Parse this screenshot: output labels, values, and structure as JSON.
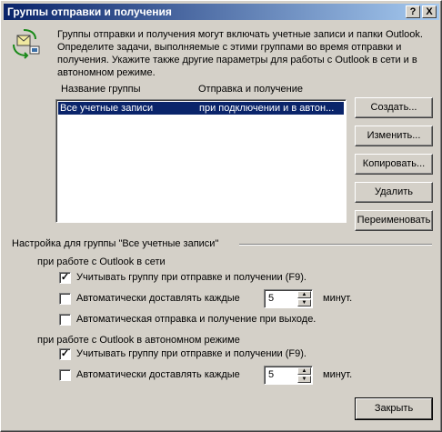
{
  "window": {
    "title": "Группы отправки и получения",
    "help_btn": "?",
    "close_btn": "X"
  },
  "intro": "Группы отправки и получения могут включать учетные записи и папки Outlook. Определите задачи, выполняемые с этими группами во время отправки и получения. Укажите также другие параметры для работы с Outlook в сети и в автономном режиме.",
  "list": {
    "headers": [
      "Название группы",
      "Отправка и получение"
    ],
    "rows": [
      {
        "name": "Все учетные записи",
        "when": "при подключении и в автон..."
      }
    ]
  },
  "buttons": {
    "create": "Создать...",
    "edit": "Изменить...",
    "copy": "Копировать...",
    "delete": "Удалить",
    "rename": "Переименовать"
  },
  "group_settings": {
    "title": "Настройка для группы \"Все учетные записи\"",
    "online": {
      "label": "при работе с Outlook в сети",
      "include": {
        "label": "Учитывать группу при отправке и получении (F9).",
        "checked": true
      },
      "auto": {
        "label": "Автоматически доставлять каждые",
        "checked": false,
        "value": "5",
        "unit": "минут."
      },
      "on_exit": {
        "label": "Автоматическая отправка и получение при выходе.",
        "checked": false
      }
    },
    "offline": {
      "label": "при работе с Outlook в автономном режиме",
      "include": {
        "label": "Учитывать группу при отправке и получении (F9).",
        "checked": true
      },
      "auto": {
        "label": "Автоматически доставлять каждые",
        "checked": false,
        "value": "5",
        "unit": "минут."
      }
    }
  },
  "close_label": "Закрыть"
}
